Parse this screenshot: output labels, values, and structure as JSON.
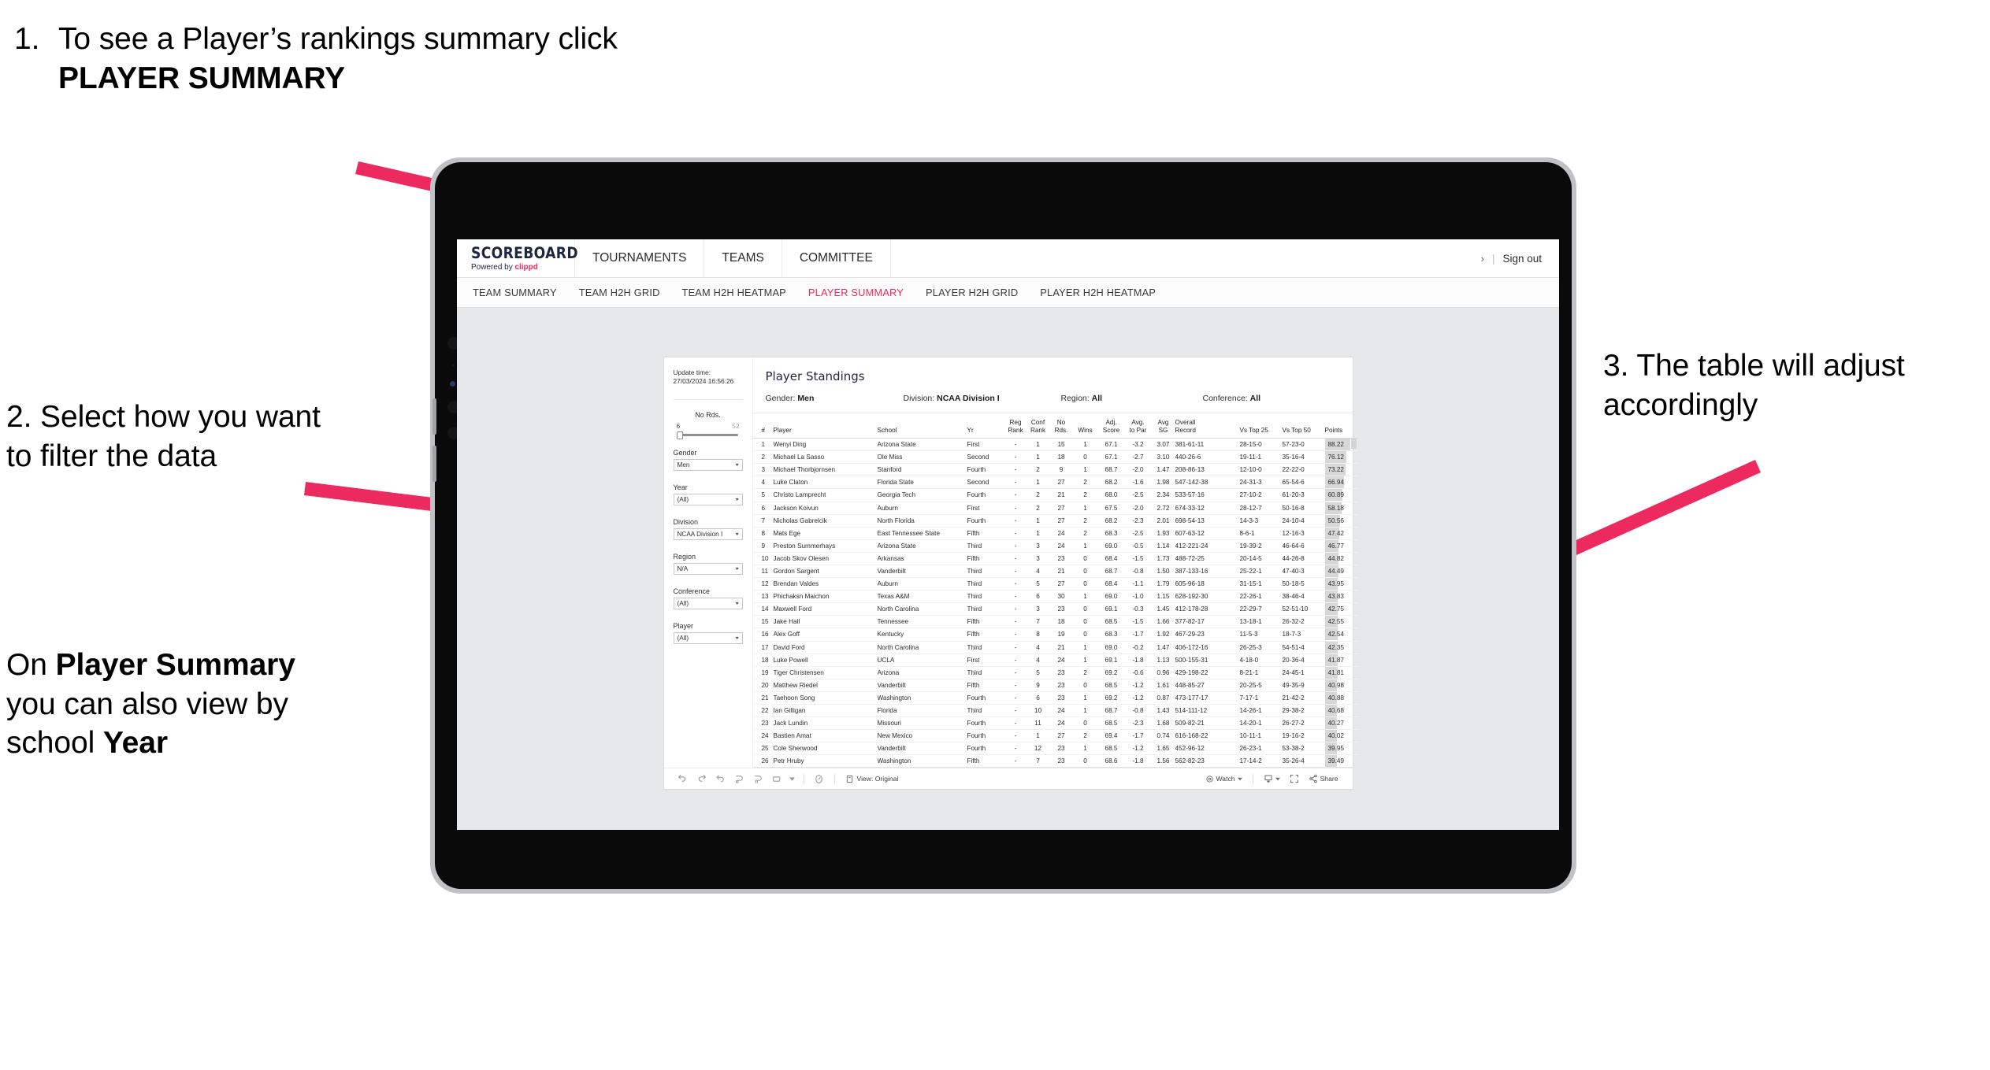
{
  "annotations": {
    "step1": {
      "number": "1.",
      "text_before": "To see a Player’s rankings summary click ",
      "bold": "PLAYER SUMMARY"
    },
    "step2": {
      "text": "2. Select how you want to filter the data"
    },
    "step2b": {
      "prefix": "On ",
      "bold1": "Player Summary",
      "middle": " you can also view by school ",
      "bold2": "Year"
    },
    "step3": {
      "text": "3. The table will adjust accordingly"
    },
    "arrow_color": "#ec2a60"
  },
  "app": {
    "logo": {
      "main": "SCOREBOARD",
      "powered": "Powered by",
      "brand": "clippd"
    },
    "topnav": [
      "TOURNAMENTS",
      "TEAMS",
      "COMMITTEE"
    ],
    "account": {
      "chevron": "›",
      "separator": "|",
      "signout": "Sign out"
    },
    "subnav": [
      {
        "label": "TEAM SUMMARY",
        "active": false
      },
      {
        "label": "TEAM H2H GRID",
        "active": false
      },
      {
        "label": "TEAM H2H HEATMAP",
        "active": false
      },
      {
        "label": "PLAYER SUMMARY",
        "active": true
      },
      {
        "label": "PLAYER H2H GRID",
        "active": false
      },
      {
        "label": "PLAYER H2H HEATMAP",
        "active": false
      }
    ],
    "accent_color": "#ef2a5f"
  },
  "filters": {
    "update_label": "Update time:",
    "update_value": "27/03/2024 16:56:26",
    "slider": {
      "title": "No Rds.",
      "min": "6",
      "max": "52",
      "value_pct": 4
    },
    "selects": [
      {
        "label": "Gender",
        "value": "Men"
      },
      {
        "label": "Year",
        "value": "(All)"
      },
      {
        "label": "Division",
        "value": "NCAA Division I"
      },
      {
        "label": "Region",
        "value": "N/A"
      },
      {
        "label": "Conference",
        "value": "(All)"
      },
      {
        "label": "Player",
        "value": "(All)"
      }
    ]
  },
  "report": {
    "title": "Player Standings",
    "subtitle": [
      {
        "label": "Gender:",
        "value": "Men"
      },
      {
        "label": "Division:",
        "value": "NCAA Division I"
      },
      {
        "label": "Region:",
        "value": "All"
      },
      {
        "label": "Conference:",
        "value": "All"
      }
    ],
    "columns": [
      {
        "l1": "#",
        "l2": ""
      },
      {
        "l1": "Player",
        "l2": ""
      },
      {
        "l1": "School",
        "l2": ""
      },
      {
        "l1": "Yr",
        "l2": ""
      },
      {
        "l1": "Reg",
        "l2": "Rank"
      },
      {
        "l1": "Conf",
        "l2": "Rank"
      },
      {
        "l1": "No",
        "l2": "Rds."
      },
      {
        "l1": "Wins",
        "l2": ""
      },
      {
        "l1": "Adj.",
        "l2": "Score"
      },
      {
        "l1": "Avg.",
        "l2": "to Par"
      },
      {
        "l1": "Avg",
        "l2": "SG"
      },
      {
        "l1": "Overall",
        "l2": "Record"
      },
      {
        "l1": "Vs Top 25",
        "l2": ""
      },
      {
        "l1": "Vs Top 50",
        "l2": ""
      },
      {
        "l1": "Points",
        "l2": ""
      }
    ],
    "max_points": 88.22,
    "rows": [
      {
        "rank": "1",
        "player": "Wenyi Ding",
        "school": "Arizona State",
        "yr": "First",
        "reg": "-",
        "conf": "1",
        "rds": "15",
        "wins": "1",
        "adj": "67.1",
        "par": "-3.2",
        "sg": "3.07",
        "record": "381-61-11",
        "t25": "28-15-0",
        "t50": "57-23-0",
        "points": "88.22"
      },
      {
        "rank": "2",
        "player": "Michael La Sasso",
        "school": "Ole Miss",
        "yr": "Second",
        "reg": "-",
        "conf": "1",
        "rds": "18",
        "wins": "0",
        "adj": "67.1",
        "par": "-2.7",
        "sg": "3.10",
        "record": "440-26-6",
        "t25": "19-11-1",
        "t50": "35-16-4",
        "points": "76.12"
      },
      {
        "rank": "3",
        "player": "Michael Thorbjornsen",
        "school": "Stanford",
        "yr": "Fourth",
        "reg": "-",
        "conf": "2",
        "rds": "9",
        "wins": "1",
        "adj": "68.7",
        "par": "-2.0",
        "sg": "1.47",
        "record": "208-86-13",
        "t25": "12-10-0",
        "t50": "22-22-0",
        "points": "73.22"
      },
      {
        "rank": "4",
        "player": "Luke Claton",
        "school": "Florida State",
        "yr": "Second",
        "reg": "-",
        "conf": "1",
        "rds": "27",
        "wins": "2",
        "adj": "68.2",
        "par": "-1.6",
        "sg": "1.98",
        "record": "547-142-38",
        "t25": "24-31-3",
        "t50": "65-54-6",
        "points": "66.94"
      },
      {
        "rank": "5",
        "player": "Christo Lamprecht",
        "school": "Georgia Tech",
        "yr": "Fourth",
        "reg": "-",
        "conf": "2",
        "rds": "21",
        "wins": "2",
        "adj": "68.0",
        "par": "-2.5",
        "sg": "2.34",
        "record": "533-57-16",
        "t25": "27-10-2",
        "t50": "61-20-3",
        "points": "60.89"
      },
      {
        "rank": "6",
        "player": "Jackson Koivun",
        "school": "Auburn",
        "yr": "First",
        "reg": "-",
        "conf": "2",
        "rds": "27",
        "wins": "1",
        "adj": "67.5",
        "par": "-2.0",
        "sg": "2.72",
        "record": "674-33-12",
        "t25": "28-12-7",
        "t50": "50-16-8",
        "points": "58.18"
      },
      {
        "rank": "7",
        "player": "Nicholas Gabrelcik",
        "school": "North Florida",
        "yr": "Fourth",
        "reg": "-",
        "conf": "1",
        "rds": "27",
        "wins": "2",
        "adj": "68.2",
        "par": "-2.3",
        "sg": "2.01",
        "record": "698-54-13",
        "t25": "14-3-3",
        "t50": "24-10-4",
        "points": "50.56"
      },
      {
        "rank": "8",
        "player": "Mats Ege",
        "school": "East Tennessee State",
        "yr": "Fifth",
        "reg": "-",
        "conf": "1",
        "rds": "24",
        "wins": "2",
        "adj": "68.3",
        "par": "-2.5",
        "sg": "1.93",
        "record": "607-63-12",
        "t25": "8-6-1",
        "t50": "12-16-3",
        "points": "47.42"
      },
      {
        "rank": "9",
        "player": "Preston Summerhays",
        "school": "Arizona State",
        "yr": "Third",
        "reg": "-",
        "conf": "3",
        "rds": "24",
        "wins": "1",
        "adj": "69.0",
        "par": "-0.5",
        "sg": "1.14",
        "record": "412-221-24",
        "t25": "19-39-2",
        "t50": "46-64-6",
        "points": "46.77"
      },
      {
        "rank": "10",
        "player": "Jacob Skov Olesen",
        "school": "Arkansas",
        "yr": "Fifth",
        "reg": "-",
        "conf": "3",
        "rds": "23",
        "wins": "0",
        "adj": "68.4",
        "par": "-1.5",
        "sg": "1.73",
        "record": "488-72-25",
        "t25": "20-14-5",
        "t50": "44-26-8",
        "points": "44.82"
      },
      {
        "rank": "11",
        "player": "Gordon Sargent",
        "school": "Vanderbilt",
        "yr": "Third",
        "reg": "-",
        "conf": "4",
        "rds": "21",
        "wins": "0",
        "adj": "68.7",
        "par": "-0.8",
        "sg": "1.50",
        "record": "387-133-16",
        "t25": "25-22-1",
        "t50": "47-40-3",
        "points": "44.49"
      },
      {
        "rank": "12",
        "player": "Brendan Valdes",
        "school": "Auburn",
        "yr": "Third",
        "reg": "-",
        "conf": "5",
        "rds": "27",
        "wins": "0",
        "adj": "68.4",
        "par": "-1.1",
        "sg": "1.79",
        "record": "605-96-18",
        "t25": "31-15-1",
        "t50": "50-18-5",
        "points": "43.95"
      },
      {
        "rank": "13",
        "player": "Phichaksn Maichon",
        "school": "Texas A&M",
        "yr": "Third",
        "reg": "-",
        "conf": "6",
        "rds": "30",
        "wins": "1",
        "adj": "69.0",
        "par": "-1.0",
        "sg": "1.15",
        "record": "628-192-30",
        "t25": "22-26-1",
        "t50": "38-46-4",
        "points": "43.83"
      },
      {
        "rank": "14",
        "player": "Maxwell Ford",
        "school": "North Carolina",
        "yr": "Third",
        "reg": "-",
        "conf": "3",
        "rds": "23",
        "wins": "0",
        "adj": "69.1",
        "par": "-0.3",
        "sg": "1.45",
        "record": "412-178-28",
        "t25": "22-29-7",
        "t50": "52-51-10",
        "points": "42.75"
      },
      {
        "rank": "15",
        "player": "Jake Hall",
        "school": "Tennessee",
        "yr": "Fifth",
        "reg": "-",
        "conf": "7",
        "rds": "18",
        "wins": "0",
        "adj": "68.5",
        "par": "-1.5",
        "sg": "1.66",
        "record": "377-82-17",
        "t25": "13-18-1",
        "t50": "26-32-2",
        "points": "42.55"
      },
      {
        "rank": "16",
        "player": "Alex Goff",
        "school": "Kentucky",
        "yr": "Fifth",
        "reg": "-",
        "conf": "8",
        "rds": "19",
        "wins": "0",
        "adj": "68.3",
        "par": "-1.7",
        "sg": "1.92",
        "record": "467-29-23",
        "t25": "11-5-3",
        "t50": "18-7-3",
        "points": "42.54"
      },
      {
        "rank": "17",
        "player": "David Ford",
        "school": "North Carolina",
        "yr": "Third",
        "reg": "-",
        "conf": "4",
        "rds": "21",
        "wins": "1",
        "adj": "69.0",
        "par": "-0.2",
        "sg": "1.47",
        "record": "406-172-16",
        "t25": "26-25-3",
        "t50": "54-51-4",
        "points": "42.35"
      },
      {
        "rank": "18",
        "player": "Luke Powell",
        "school": "UCLA",
        "yr": "First",
        "reg": "-",
        "conf": "4",
        "rds": "24",
        "wins": "1",
        "adj": "69.1",
        "par": "-1.8",
        "sg": "1.13",
        "record": "500-155-31",
        "t25": "4-18-0",
        "t50": "20-36-4",
        "points": "41.87"
      },
      {
        "rank": "19",
        "player": "Tiger Christensen",
        "school": "Arizona",
        "yr": "Third",
        "reg": "-",
        "conf": "5",
        "rds": "23",
        "wins": "2",
        "adj": "69.2",
        "par": "-0.6",
        "sg": "0.96",
        "record": "429-198-22",
        "t25": "8-21-1",
        "t50": "24-45-1",
        "points": "41.81"
      },
      {
        "rank": "20",
        "player": "Matthew Riedel",
        "school": "Vanderbilt",
        "yr": "Fifth",
        "reg": "-",
        "conf": "9",
        "rds": "23",
        "wins": "0",
        "adj": "68.5",
        "par": "-1.2",
        "sg": "1.61",
        "record": "448-85-27",
        "t25": "20-25-5",
        "t50": "49-35-9",
        "points": "40.98"
      },
      {
        "rank": "21",
        "player": "Taehoon Song",
        "school": "Washington",
        "yr": "Fourth",
        "reg": "-",
        "conf": "6",
        "rds": "23",
        "wins": "1",
        "adj": "69.2",
        "par": "-1.2",
        "sg": "0.87",
        "record": "473-177-17",
        "t25": "7-17-1",
        "t50": "21-42-2",
        "points": "40.88"
      },
      {
        "rank": "22",
        "player": "Ian Gilligan",
        "school": "Florida",
        "yr": "Third",
        "reg": "-",
        "conf": "10",
        "rds": "24",
        "wins": "1",
        "adj": "68.7",
        "par": "-0.8",
        "sg": "1.43",
        "record": "514-111-12",
        "t25": "14-26-1",
        "t50": "29-38-2",
        "points": "40.68"
      },
      {
        "rank": "23",
        "player": "Jack Lundin",
        "school": "Missouri",
        "yr": "Fourth",
        "reg": "-",
        "conf": "11",
        "rds": "24",
        "wins": "0",
        "adj": "68.5",
        "par": "-2.3",
        "sg": "1.68",
        "record": "509-82-21",
        "t25": "14-20-1",
        "t50": "26-27-2",
        "points": "40.27"
      },
      {
        "rank": "24",
        "player": "Bastien Amat",
        "school": "New Mexico",
        "yr": "Fourth",
        "reg": "-",
        "conf": "1",
        "rds": "27",
        "wins": "2",
        "adj": "69.4",
        "par": "-1.7",
        "sg": "0.74",
        "record": "616-168-22",
        "t25": "10-11-1",
        "t50": "19-16-2",
        "points": "40.02"
      },
      {
        "rank": "25",
        "player": "Cole Sherwood",
        "school": "Vanderbilt",
        "yr": "Fourth",
        "reg": "-",
        "conf": "12",
        "rds": "23",
        "wins": "1",
        "adj": "68.5",
        "par": "-1.2",
        "sg": "1.65",
        "record": "452-96-12",
        "t25": "26-23-1",
        "t50": "53-38-2",
        "points": "39.95"
      },
      {
        "rank": "26",
        "player": "Petr Hruby",
        "school": "Washington",
        "yr": "Fifth",
        "reg": "-",
        "conf": "7",
        "rds": "23",
        "wins": "0",
        "adj": "68.6",
        "par": "-1.8",
        "sg": "1.56",
        "record": "562-82-23",
        "t25": "17-14-2",
        "t50": "35-26-4",
        "points": "39.49"
      }
    ]
  },
  "toolbar": {
    "left_icons": [
      "undo-icon",
      "redo-icon",
      "revert-icon",
      "refresh-icon",
      "pause-icon",
      "rectangle-select-icon",
      "caret-down-icon"
    ],
    "metric_icon": "dashboard-speed-icon",
    "view_label": "View: Original",
    "view_icon": "device-icon",
    "watch_label": "Watch",
    "watch_icon": "eye-icon",
    "download_icon": "download-icon",
    "fullscreen_icon": "fullscreen-icon",
    "share_label": "Share",
    "share_icon": "share-icon"
  }
}
